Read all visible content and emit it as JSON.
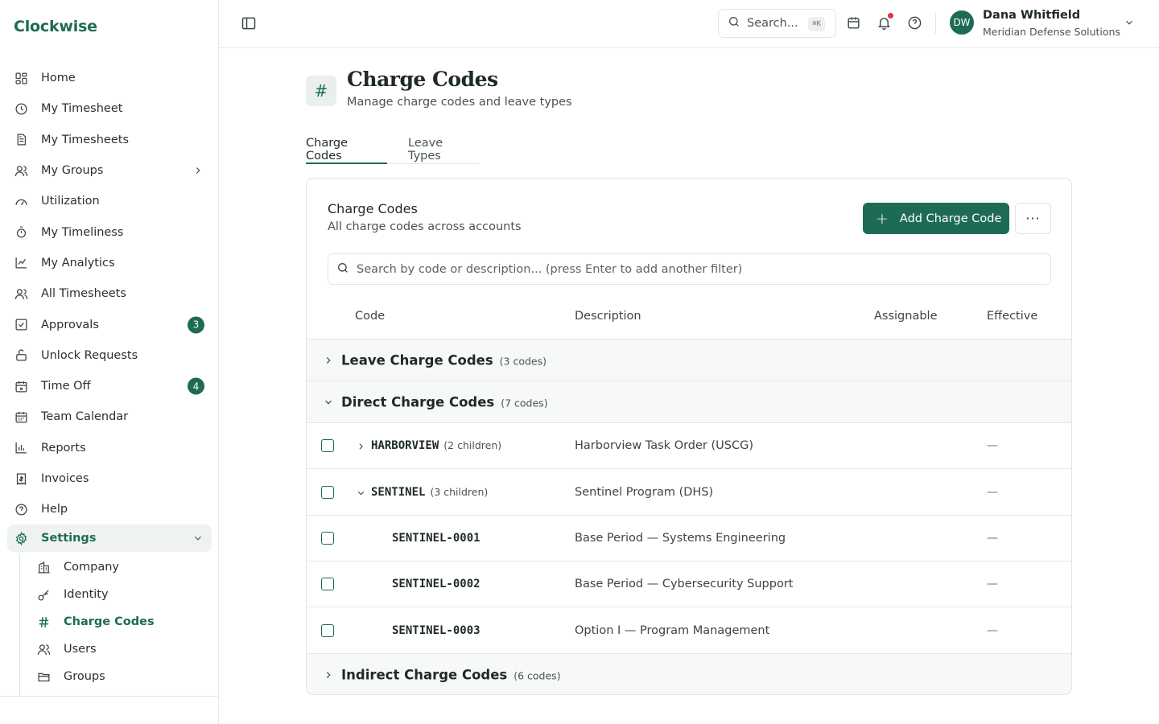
{
  "brand": "Clockwise",
  "nav": [
    {
      "label": "Home",
      "icon": "grid-icon"
    },
    {
      "label": "My Timesheet",
      "icon": "clock-icon"
    },
    {
      "label": "My Timesheets",
      "icon": "document-icon"
    },
    {
      "label": "My Groups",
      "icon": "users-icon"
    },
    {
      "label": "Utilization",
      "icon": "gauge-icon"
    },
    {
      "label": "My Timeliness",
      "icon": "stopwatch-icon"
    },
    {
      "label": "My Analytics",
      "icon": "line-chart-icon"
    },
    {
      "label": "All Timesheets",
      "icon": "users-icon"
    },
    {
      "label": "Approvals",
      "icon": "check-square-icon",
      "badge": "3"
    },
    {
      "label": "Unlock Requests",
      "icon": "unlock-icon"
    },
    {
      "label": "Time Off",
      "icon": "calendar-x-icon",
      "badge": "4"
    },
    {
      "label": "Team Calendar",
      "icon": "calendar-icon"
    },
    {
      "label": "Reports",
      "icon": "bar-chart-icon"
    },
    {
      "label": "Invoices",
      "icon": "receipt-icon"
    },
    {
      "label": "Help",
      "icon": "help-circle-icon"
    },
    {
      "label": "Settings",
      "icon": "gear-icon"
    }
  ],
  "settings_sub": [
    {
      "label": "Company",
      "icon": "building-icon"
    },
    {
      "label": "Identity",
      "icon": "key-icon"
    },
    {
      "label": "Charge Codes",
      "icon": "hash-icon"
    },
    {
      "label": "Users",
      "icon": "users-icon"
    },
    {
      "label": "Groups",
      "icon": "folder-icon"
    }
  ],
  "topbar": {
    "search_placeholder": "Search...",
    "search_shortcut": "⌘K",
    "user_initials": "DW",
    "user_name": "Dana Whitfield",
    "user_org": "Meridian Defense Solutions"
  },
  "page": {
    "title": "Charge Codes",
    "subtitle": "Manage charge codes and leave types",
    "icon": "#"
  },
  "tabs": [
    "Charge Codes",
    "Leave Types"
  ],
  "card": {
    "title": "Charge Codes",
    "subtitle": "All charge codes across accounts",
    "add_label": "Add Charge Code",
    "more_label": "···",
    "filter_placeholder": "Search by code or description... (press Enter to add another filter)"
  },
  "columns": [
    "Code",
    "Description",
    "Assignable",
    "Effective"
  ],
  "groups": [
    {
      "label": "Leave Charge Codes",
      "count": "(3 codes)"
    },
    {
      "label": "Direct Charge Codes",
      "count": "(7 codes)"
    },
    {
      "label": "Indirect Charge Codes",
      "count": "(6 codes)"
    }
  ],
  "rows": [
    {
      "code": "HARBORVIEW",
      "children": "(2 children)",
      "description": "Harborview Task Order (USCG)",
      "effective": "—"
    },
    {
      "code": "SENTINEL",
      "children": "(3 children)",
      "description": "Sentinel Program (DHS)",
      "effective": "—"
    },
    {
      "code": "SENTINEL-0001",
      "children": "",
      "description": "Base Period — Systems Engineering",
      "effective": "—"
    },
    {
      "code": "SENTINEL-0002",
      "children": "",
      "description": "Base Period — Cybersecurity Support",
      "effective": "—"
    },
    {
      "code": "SENTINEL-0003",
      "children": "",
      "description": "Option I — Program Management",
      "effective": "—"
    }
  ],
  "colors": {
    "accent": "#1e6b55",
    "badge": "#1e6b55",
    "notification": "#e0353b"
  }
}
